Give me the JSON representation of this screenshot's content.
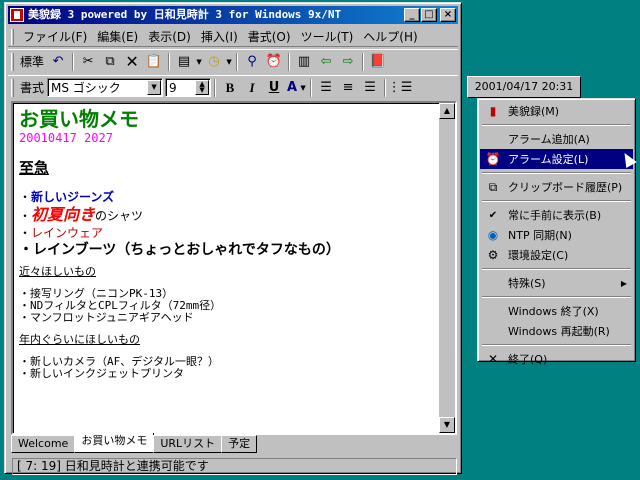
{
  "window": {
    "title": "美貌録 3 powered by 日和見時計 3 for Windows 9x/NT",
    "minimize": "_",
    "maximize": "□",
    "close": "×"
  },
  "menu": [
    "ファイル(F)",
    "編集(E)",
    "表示(D)",
    "挿入(I)",
    "書式(O)",
    "ツール(T)",
    "ヘルプ(H)"
  ],
  "toolbar1": {
    "label": "標準"
  },
  "toolbar2": {
    "label": "書式",
    "font": "MS ゴシック",
    "size": "9",
    "bold": "B",
    "italic": "I",
    "underline": "U",
    "color": "A"
  },
  "document": {
    "title": "お買い物メモ",
    "date": "20010417 2027",
    "section1": "至急",
    "urgent_items": [
      {
        "prefix": "・",
        "text": "新しいジーンズ"
      },
      {
        "prefix": "・",
        "text": "初夏向き",
        "suffix": "のシャツ"
      },
      {
        "prefix": "・",
        "text": "レインウェア"
      },
      {
        "prefix": "・",
        "text": "レインブーツ（ちょっとおしゃれでタフなもの）"
      }
    ],
    "section2": "近々ほしいもの",
    "soon_items": [
      "・接写リング（ニコンPK-13）",
      "・NDフィルタとCPLフィルタ（72mm径）",
      "・マンフロットジュニアギアヘッド"
    ],
    "section3": "年内ぐらいにほしいもの",
    "year_items": [
      "・新しいカメラ（AF、デジタル一眼？）",
      "・新しいインクジェットプリンタ"
    ]
  },
  "tabs": [
    "Welcome",
    "お買い物メモ",
    "URLリスト",
    "予定"
  ],
  "status": "[ 7: 19] 日和見時計と連携可能です",
  "clock": "2001/04/17 20:31",
  "context_menu": [
    {
      "label": "美貌録(M)",
      "icon": "book-icon"
    },
    {
      "label": "アラーム追加(A)",
      "icon": ""
    },
    {
      "label": "アラーム設定(L)",
      "icon": "alarm-clock-icon"
    },
    {
      "label": "クリップボード履歴(P)",
      "icon": "clipboard-icon"
    },
    {
      "label": "常に手前に表示(B)",
      "icon": "check-icon"
    },
    {
      "label": "NTP 同期(N)",
      "icon": "globe-icon"
    },
    {
      "label": "環境設定(C)",
      "icon": "settings-icon"
    },
    {
      "label": "特殊(S)",
      "icon": ""
    },
    {
      "label": "Windows 終了(X)",
      "icon": ""
    },
    {
      "label": "Windows 再起動(R)",
      "icon": ""
    },
    {
      "label": "終了(Q)",
      "icon": "x-icon"
    }
  ],
  "colors": {
    "title": "#008000",
    "date": "#ff00ff",
    "blue_item": "#0000c0",
    "red_item": "#ff0000",
    "selection": "#000080",
    "desktop": "#008080"
  }
}
